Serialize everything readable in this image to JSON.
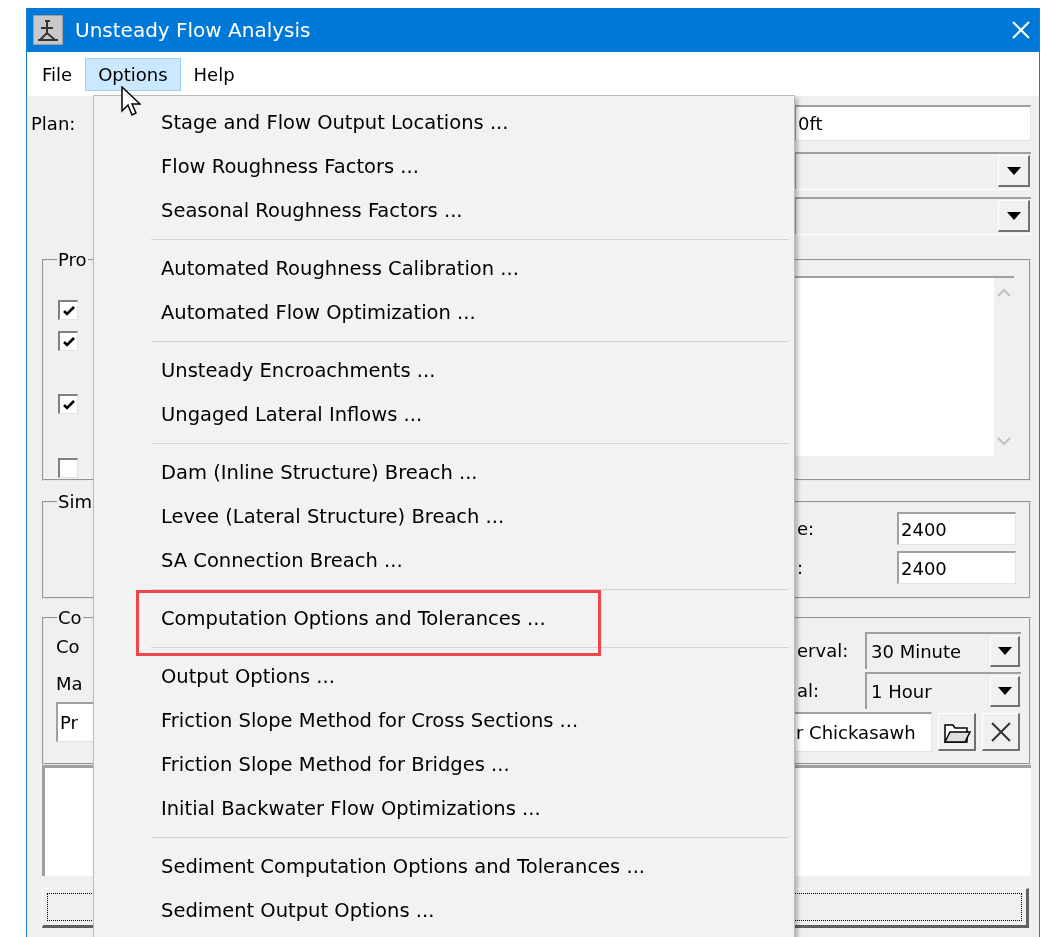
{
  "window": {
    "title": "Unsteady Flow Analysis"
  },
  "menu_bar": [
    {
      "label": "File",
      "selected": false
    },
    {
      "label": "Options",
      "selected": true
    },
    {
      "label": "Help",
      "selected": false
    }
  ],
  "plan": {
    "label": "Plan:",
    "value": "0ft"
  },
  "programs_group": {
    "legend": "Pro",
    "checkboxes": [
      {
        "checked": true
      },
      {
        "checked": true
      },
      {
        "checked": true
      },
      {
        "checked": false
      }
    ]
  },
  "simulation_group": {
    "legend": "Sim",
    "fields": [
      {
        "label": "e:",
        "value": "2400"
      },
      {
        "label": ":",
        "value": "2400"
      }
    ]
  },
  "computation_group": {
    "legend": "Co",
    "labels": [
      "Co",
      "Ma"
    ],
    "left_field": "Pr",
    "intervals": [
      {
        "label": "erval:",
        "value": "30 Minute"
      },
      {
        "label": "al:",
        "value": "1 Hour"
      }
    ],
    "file_field": "r Chickasawh"
  },
  "options_menu": {
    "groups": [
      {
        "items": [
          {
            "label": "Stage and Flow Output Locations ...",
            "highlighted": false
          },
          {
            "label": "Flow Roughness Factors ...",
            "highlighted": false
          },
          {
            "label": "Seasonal Roughness Factors ...",
            "highlighted": false
          }
        ]
      },
      {
        "items": [
          {
            "label": "Automated Roughness Calibration ...",
            "highlighted": false
          },
          {
            "label": "Automated Flow Optimization ...",
            "highlighted": false
          }
        ]
      },
      {
        "items": [
          {
            "label": "Unsteady Encroachments ...",
            "highlighted": false
          },
          {
            "label": "Ungaged Lateral Inflows ...",
            "highlighted": false
          }
        ]
      },
      {
        "items": [
          {
            "label": "Dam (Inline Structure) Breach ...",
            "highlighted": false
          },
          {
            "label": "Levee (Lateral Structure) Breach ...",
            "highlighted": false
          },
          {
            "label": "SA Connection Breach ...",
            "highlighted": false
          }
        ]
      },
      {
        "items": [
          {
            "label": "Computation Options and Tolerances ...",
            "highlighted": true
          }
        ]
      },
      {
        "items": [
          {
            "label": "Output Options ...",
            "highlighted": false
          },
          {
            "label": "Friction Slope Method for Cross Sections ...",
            "highlighted": false
          },
          {
            "label": "Friction Slope Method for Bridges ...",
            "highlighted": false
          },
          {
            "label": "Initial Backwater Flow Optimizations ...",
            "highlighted": false
          }
        ]
      },
      {
        "items": [
          {
            "label": "Sediment Computation Options and Tolerances ...",
            "highlighted": false
          },
          {
            "label": "Sediment Output Options ...",
            "highlighted": false
          }
        ]
      }
    ]
  }
}
